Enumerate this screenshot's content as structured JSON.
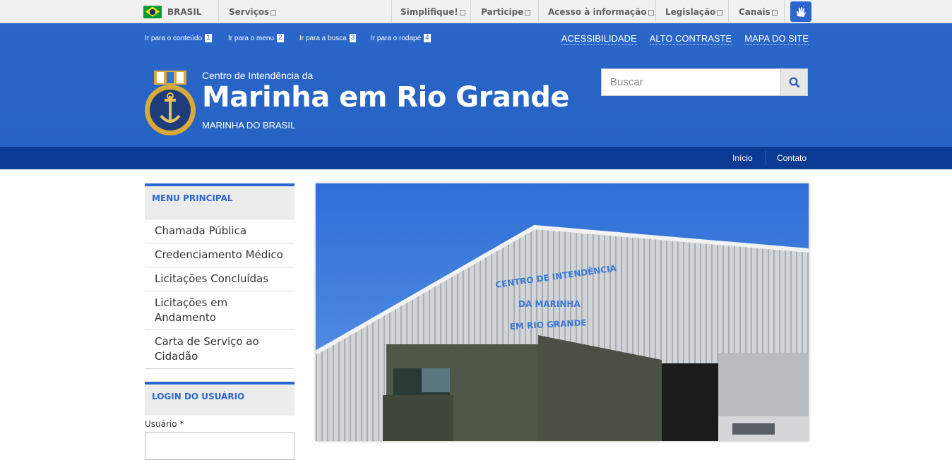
{
  "govbar": {
    "country": "BRASIL",
    "items": [
      "Serviços",
      "Simplifique!",
      "Participe",
      "Acesso à informação",
      "Legislação",
      "Canais"
    ]
  },
  "skiplinks": [
    {
      "label": "Ir para o conteúdo",
      "num": "1"
    },
    {
      "label": "Ir para o menu",
      "num": "2"
    },
    {
      "label": "Ir para a busca",
      "num": "3"
    },
    {
      "label": "Ir para o rodapé",
      "num": "4"
    }
  ],
  "access": [
    "ACESSIBILIDADE",
    "ALTO CONTRASTE",
    "MAPA DO SITE"
  ],
  "site": {
    "pre": "Centro de Intendência da",
    "title": "Marinha em Rio Grande",
    "sub": "MARINHA DO BRASIL",
    "logo_text": "MARINHA DO BRASIL"
  },
  "search": {
    "placeholder": "Buscar"
  },
  "servbar": [
    "Início",
    "Contato"
  ],
  "sidebar": {
    "menu_title": "MENU PRINCIPAL",
    "items": [
      "Chamada Pública",
      "Credenciamento Médico",
      "Licitações Concluídas",
      "Licitações em Andamento",
      "Carta de Serviço ao Cidadão"
    ],
    "login_title": "LOGIN DO USUÁRIO",
    "user_label": "Usuário *"
  },
  "hero": {
    "sign": [
      "CENTRO DE INTENDÊNCIA",
      "DA MARINHA",
      "EM RIO GRANDE"
    ]
  },
  "colors": {
    "primary": "#2c66ce",
    "dark": "#0b3a93"
  }
}
